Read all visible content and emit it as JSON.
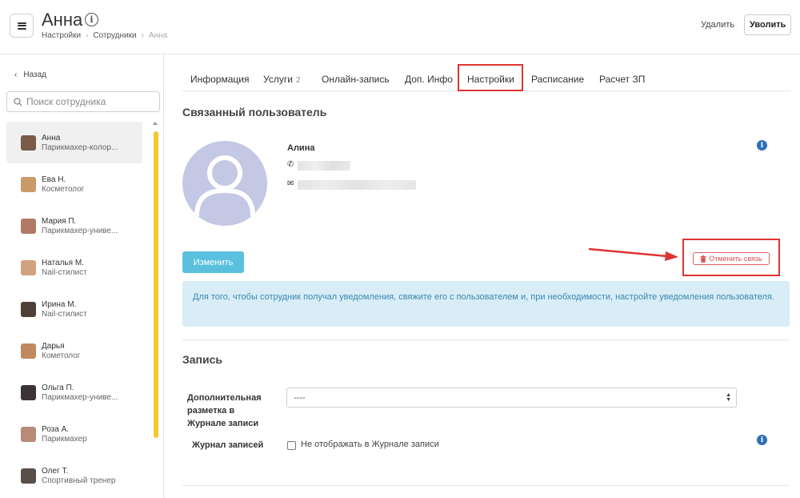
{
  "header": {
    "title": "Анна",
    "info_icon": "i",
    "breadcrumb": [
      "Настройки",
      "Сотрудники",
      "Анна"
    ],
    "delete_label": "Удалить",
    "fire_label": "Уволить"
  },
  "sidebar": {
    "back_label": "Назад",
    "search_placeholder": "Поиск сотрудника",
    "employees": [
      {
        "name": "Анна",
        "role": "Парикмахер-колор...",
        "active": true,
        "avatar_color": "#7a5a48"
      },
      {
        "name": "Ева Н.",
        "role": "Косметолог",
        "active": false,
        "avatar_color": "#c99a6a"
      },
      {
        "name": "Мария П.",
        "role": "Парикмахер-униве...",
        "active": false,
        "avatar_color": "#b07a66"
      },
      {
        "name": "Наталья М.",
        "role": "Nail-стилист",
        "active": false,
        "avatar_color": "#d1a27f"
      },
      {
        "name": "Ирина М.",
        "role": "Nail-стилист",
        "active": false,
        "avatar_color": "#4f4038"
      },
      {
        "name": "Дарья",
        "role": "Кометолог",
        "active": false,
        "avatar_color": "#c08a5e"
      },
      {
        "name": "Ольга П.",
        "role": "Парикмахер-униве...",
        "active": false,
        "avatar_color": "#3c3434"
      },
      {
        "name": "Роза А.",
        "role": "Парикмахер",
        "active": false,
        "avatar_color": "#b88a78"
      },
      {
        "name": "Олег Т.",
        "role": "Спортивный тренер",
        "active": false,
        "avatar_color": "#5a4e4a"
      }
    ]
  },
  "tabs": [
    {
      "label": "Информация",
      "badge": ""
    },
    {
      "label": "Услуги",
      "badge": "2"
    },
    {
      "label": "Онлайн-запись",
      "badge": ""
    },
    {
      "label": "Доп. Инфо",
      "badge": ""
    },
    {
      "label": "Настройки",
      "badge": "",
      "active": true
    },
    {
      "label": "Расписание",
      "badge": ""
    },
    {
      "label": "Расчет ЗП",
      "badge": ""
    }
  ],
  "linked_user": {
    "section_title": "Связанный пользователь",
    "name": "Алина",
    "edit_label": "Изменить",
    "unlink_label": "Отменить связь",
    "notice": "Для того, чтобы сотрудник получал уведомления, свяжите его с пользователем и, при необходимости, настройте уведомления пользователя."
  },
  "record": {
    "section_title": "Запись",
    "markup_label": "Дополнительная разметка в Журнале записи",
    "markup_value": "----",
    "journal_label": "Журнал записей",
    "journal_checkbox_label": "Не отображать в Журнале записи"
  },
  "colors": {
    "accent_yellow": "#f5c730",
    "edit_button": "#5bc0de",
    "notice_bg": "#d9edf7",
    "highlight_red": "#e03333",
    "info_blue": "#2f6fb7"
  }
}
